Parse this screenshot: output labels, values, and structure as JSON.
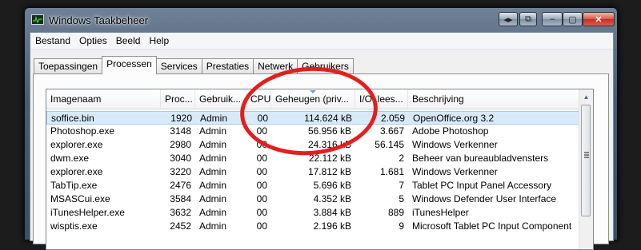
{
  "window": {
    "title": "Windows Taakbeheer",
    "controls": {
      "restore_left": "◂▸",
      "restore_right": "⧉",
      "minimize": "–",
      "maximize": "▢",
      "close": "✕"
    }
  },
  "menu": [
    "Bestand",
    "Opties",
    "Beeld",
    "Help"
  ],
  "tabs": [
    {
      "label": "Toepassingen"
    },
    {
      "label": "Processen",
      "active": true
    },
    {
      "label": "Services"
    },
    {
      "label": "Prestaties"
    },
    {
      "label": "Netwerk"
    },
    {
      "label": "Gebruikers"
    }
  ],
  "table": {
    "columns": [
      "Imagenaam",
      "Proc...",
      "Gebruik...",
      "CPU",
      "Geheugen (priv...",
      "I/O: lees...",
      "Beschrijving"
    ],
    "rows": [
      [
        "soffice.bin",
        "1920",
        "Admin",
        "00",
        "114.624 kB",
        "2.059",
        "OpenOffice.org 3.2"
      ],
      [
        "Photoshop.exe",
        "3148",
        "Admin",
        "00",
        "56.956 kB",
        "3.667",
        "Adobe Photoshop"
      ],
      [
        "explorer.exe",
        "2980",
        "Admin",
        "00",
        "24.316 kB",
        "56.145",
        "Windows Verkenner"
      ],
      [
        "dwm.exe",
        "3040",
        "Admin",
        "00",
        "22.112 kB",
        "2",
        "Beheer van bureaubladvensters"
      ],
      [
        "explorer.exe",
        "3220",
        "Admin",
        "00",
        "17.812 kB",
        "1.681",
        "Windows Verkenner"
      ],
      [
        "TabTip.exe",
        "2476",
        "Admin",
        "00",
        "5.696 kB",
        "7",
        "Tablet PC Input Panel Accessory"
      ],
      [
        "MSASCui.exe",
        "3584",
        "Admin",
        "00",
        "4.352 kB",
        "5",
        "Windows Defender User Interface"
      ],
      [
        "iTunesHelper.exe",
        "3632",
        "Admin",
        "00",
        "3.884 kB",
        "889",
        "iTunesHelper"
      ],
      [
        "wisptis.exe",
        "2452",
        "Admin",
        "00",
        "2.196 kB",
        "9",
        "Microsoft Tablet PC Input Component"
      ]
    ],
    "selected_row": 0,
    "sorted_column": "Geheugen (priv..."
  },
  "colors": {
    "annotation": "#e31e1e",
    "selection": "#d8eaf9"
  }
}
